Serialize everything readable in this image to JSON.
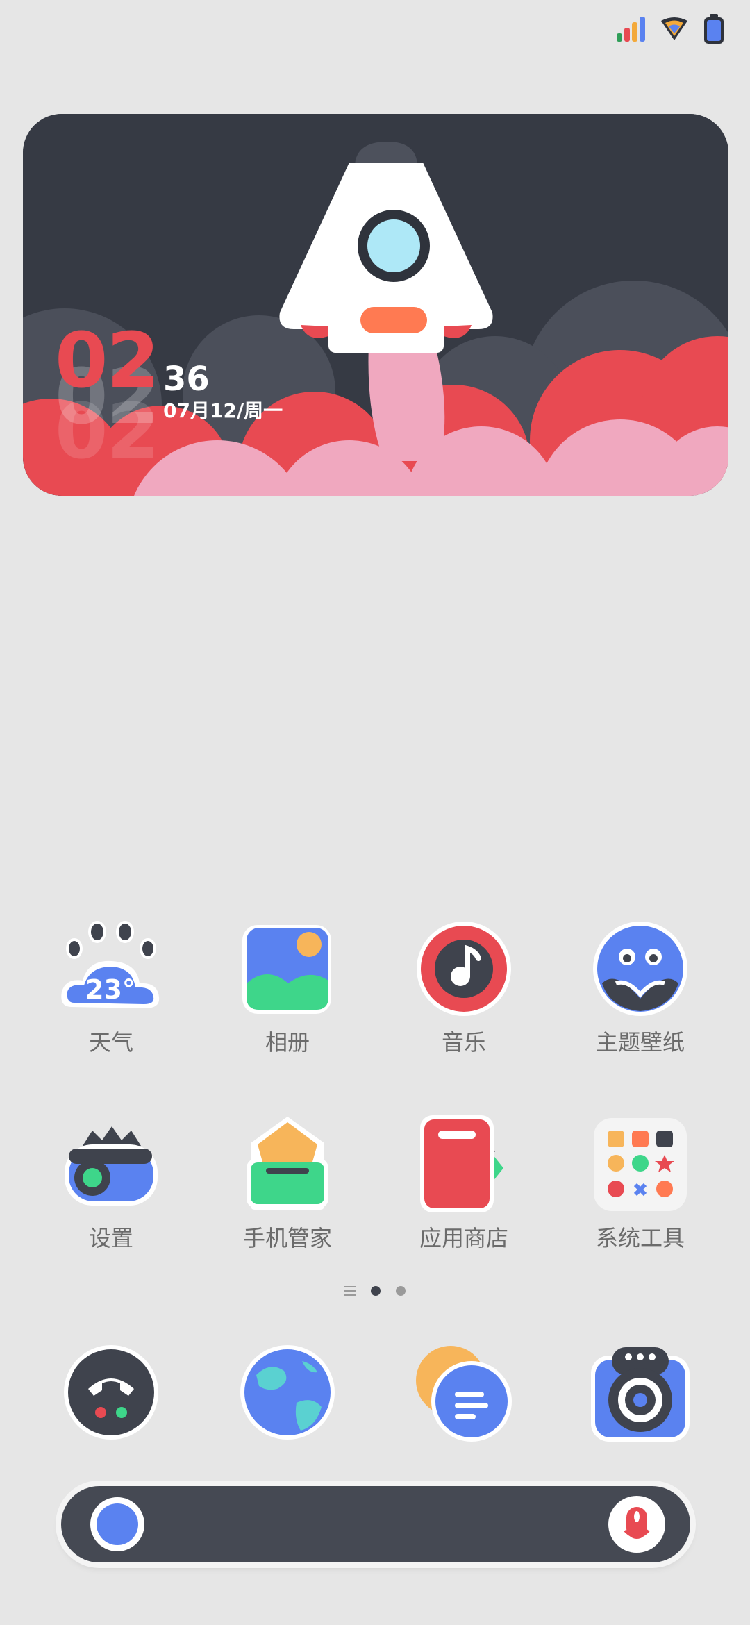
{
  "widget": {
    "hour": "02",
    "minute": "36",
    "date": "07月12/周一"
  },
  "apps": [
    {
      "label": "天气",
      "icon": "weather-icon",
      "badge": "23°"
    },
    {
      "label": "相册",
      "icon": "gallery-icon"
    },
    {
      "label": "音乐",
      "icon": "music-icon"
    },
    {
      "label": "主题壁纸",
      "icon": "themes-icon"
    },
    {
      "label": "设置",
      "icon": "settings-icon"
    },
    {
      "label": "手机管家",
      "icon": "security-icon"
    },
    {
      "label": "应用商店",
      "icon": "app-store-icon"
    },
    {
      "label": "系统工具",
      "icon": "tools-folder-icon"
    }
  ],
  "dock": [
    {
      "icon": "phone-icon"
    },
    {
      "icon": "browser-icon"
    },
    {
      "icon": "messages-icon"
    },
    {
      "icon": "camera-icon"
    }
  ],
  "colors": {
    "background": "#e6e6e6",
    "accent_red": "#e84a52",
    "accent_blue": "#5a82f0",
    "dark": "#3f434d"
  }
}
